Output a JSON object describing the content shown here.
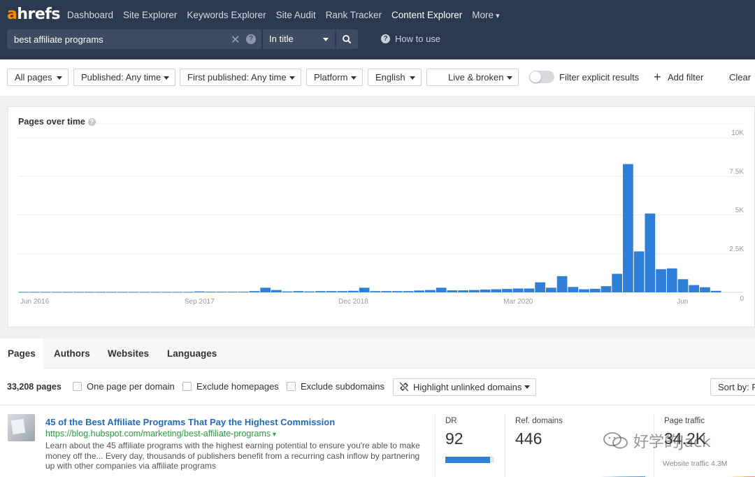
{
  "header": {
    "logo": {
      "a": "a",
      "rest": "hrefs"
    },
    "nav": [
      "Dashboard",
      "Site Explorer",
      "Keywords Explorer",
      "Site Audit",
      "Rank Tracker",
      "Content Explorer",
      "More"
    ],
    "active_nav": "Content Explorer",
    "search_value": "best affiliate programs",
    "search_mode": "In title",
    "how_to_use": "How to use"
  },
  "filters": {
    "dropdowns": [
      "All pages",
      "Published: Any time",
      "First published: Any time",
      "Platform",
      "English",
      "Live & broken"
    ],
    "explicit_label": "Filter explicit results",
    "add_filter": "Add filter",
    "clear": "Clear"
  },
  "chart_card": {
    "title": "Pages over time"
  },
  "chart_data": {
    "type": "bar",
    "title": "Pages over time",
    "x_tick_labels": [
      "Jun 2016",
      "Sep 2017",
      "Dec 2018",
      "Mar 2020",
      "Jun"
    ],
    "y_tick_labels": [
      "10K",
      "7.5K",
      "5K",
      "2.5K",
      "0"
    ],
    "ylim": [
      0,
      10000
    ],
    "grid": true,
    "color": "#2f7ed8",
    "values": [
      30,
      30,
      30,
      30,
      30,
      30,
      30,
      30,
      30,
      30,
      30,
      30,
      30,
      30,
      30,
      30,
      60,
      40,
      40,
      40,
      40,
      80,
      300,
      150,
      60,
      80,
      60,
      80,
      80,
      80,
      100,
      300,
      80,
      80,
      80,
      80,
      120,
      150,
      300,
      130,
      130,
      150,
      180,
      200,
      220,
      250,
      250,
      650,
      300,
      1050,
      350,
      200,
      230,
      400,
      1200,
      8300,
      2650,
      5100,
      1500,
      1550,
      850,
      470,
      330,
      100
    ]
  },
  "tabs": [
    "Pages",
    "Authors",
    "Websites",
    "Languages"
  ],
  "active_tab": "Pages",
  "results": {
    "count": "33,208 pages",
    "checkboxes": [
      "One page per domain",
      "Exclude homepages",
      "Exclude subdomains"
    ],
    "highlight_unlinked": "Highlight unlinked domains",
    "sort_by": "Sort by: P",
    "rows": [
      {
        "title": "45 of the Best Affiliate Programs That Pay the Highest Commission",
        "url": "https://blog.hubspot.com/marketing/best-affiliate-programs",
        "description": "Learn about the 45 affiliate programs with the highest earning potential to ensure you're able to make money off the... Every day, thousands of publishers benefit from a recurring cash inflow by partnering up with other companies via affiliate programs",
        "dr_label": "DR",
        "dr": "92",
        "dr_fraction": 0.92,
        "ref_domains_label": "Ref. domains",
        "ref_domains": "446",
        "page_traffic_label": "Page traffic",
        "page_traffic": "34.2K",
        "website_traffic": "Website traffic 4.3M"
      }
    ]
  },
  "watermark": "好学的Jack",
  "colors": {
    "header_bg": "#2b3a4e",
    "accent_orange": "#ff8800",
    "bar_blue": "#2f7ed8",
    "link_blue": "#1f6bbf",
    "url_green": "#2a9d3e"
  }
}
